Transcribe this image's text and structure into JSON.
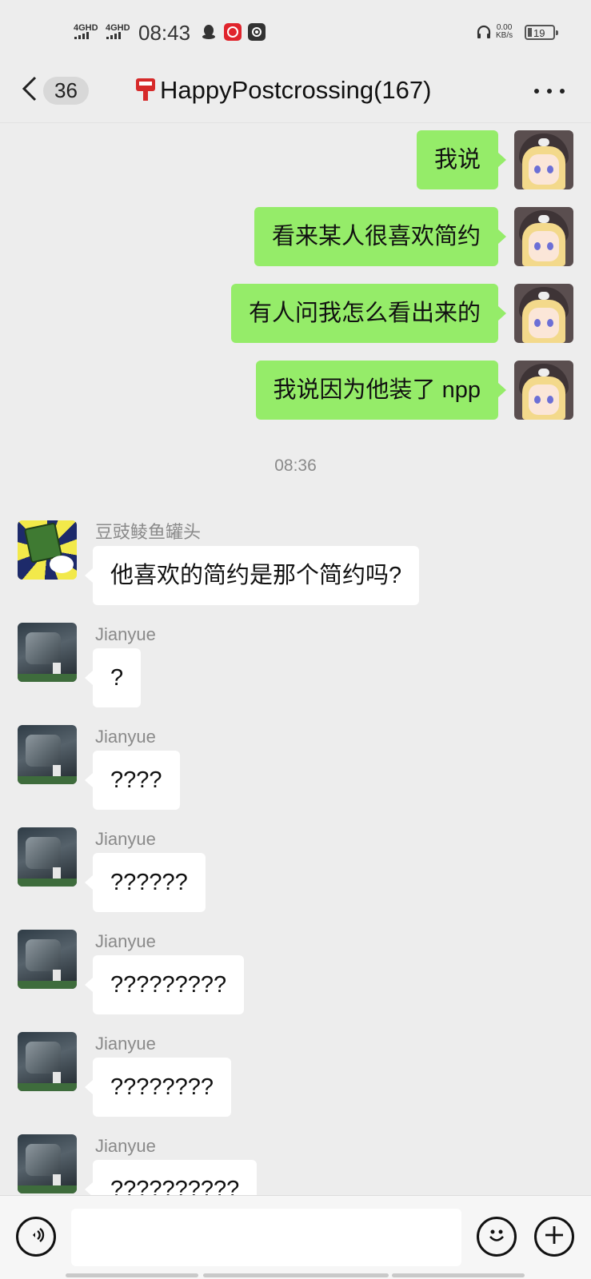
{
  "status_bar": {
    "network_1": "4GHD",
    "network_2": "4GHD",
    "time": "08:43",
    "speed_value": "0.00",
    "speed_unit": "KB/s",
    "battery": "19",
    "icons": [
      "qq-icon",
      "red-app-icon",
      "camera-app-icon",
      "headphones-icon"
    ]
  },
  "header": {
    "unread_count": "36",
    "title": "HappyPostcrossing(167)"
  },
  "messages_out": [
    {
      "text": "我说"
    },
    {
      "text": "看来某人很喜欢简约"
    },
    {
      "text": "有人问我怎么看出来的"
    },
    {
      "text": "我说因为他装了 npp"
    }
  ],
  "timestamp": "08:36",
  "messages_in": [
    {
      "sender": "豆豉鲮鱼罐头",
      "text": "他喜欢的简约是那个简约吗?"
    },
    {
      "sender": "Jianyue",
      "text": "?"
    },
    {
      "sender": "Jianyue",
      "text": "????"
    },
    {
      "sender": "Jianyue",
      "text": "??????"
    },
    {
      "sender": "Jianyue",
      "text": "?????????"
    },
    {
      "sender": "Jianyue",
      "text": "????????"
    },
    {
      "sender": "Jianyue",
      "text": "??????????"
    }
  ],
  "input_bar": {
    "placeholder": ""
  },
  "colors": {
    "background": "#ededed",
    "bubble_out": "#95ec69",
    "bubble_in": "#ffffff"
  }
}
